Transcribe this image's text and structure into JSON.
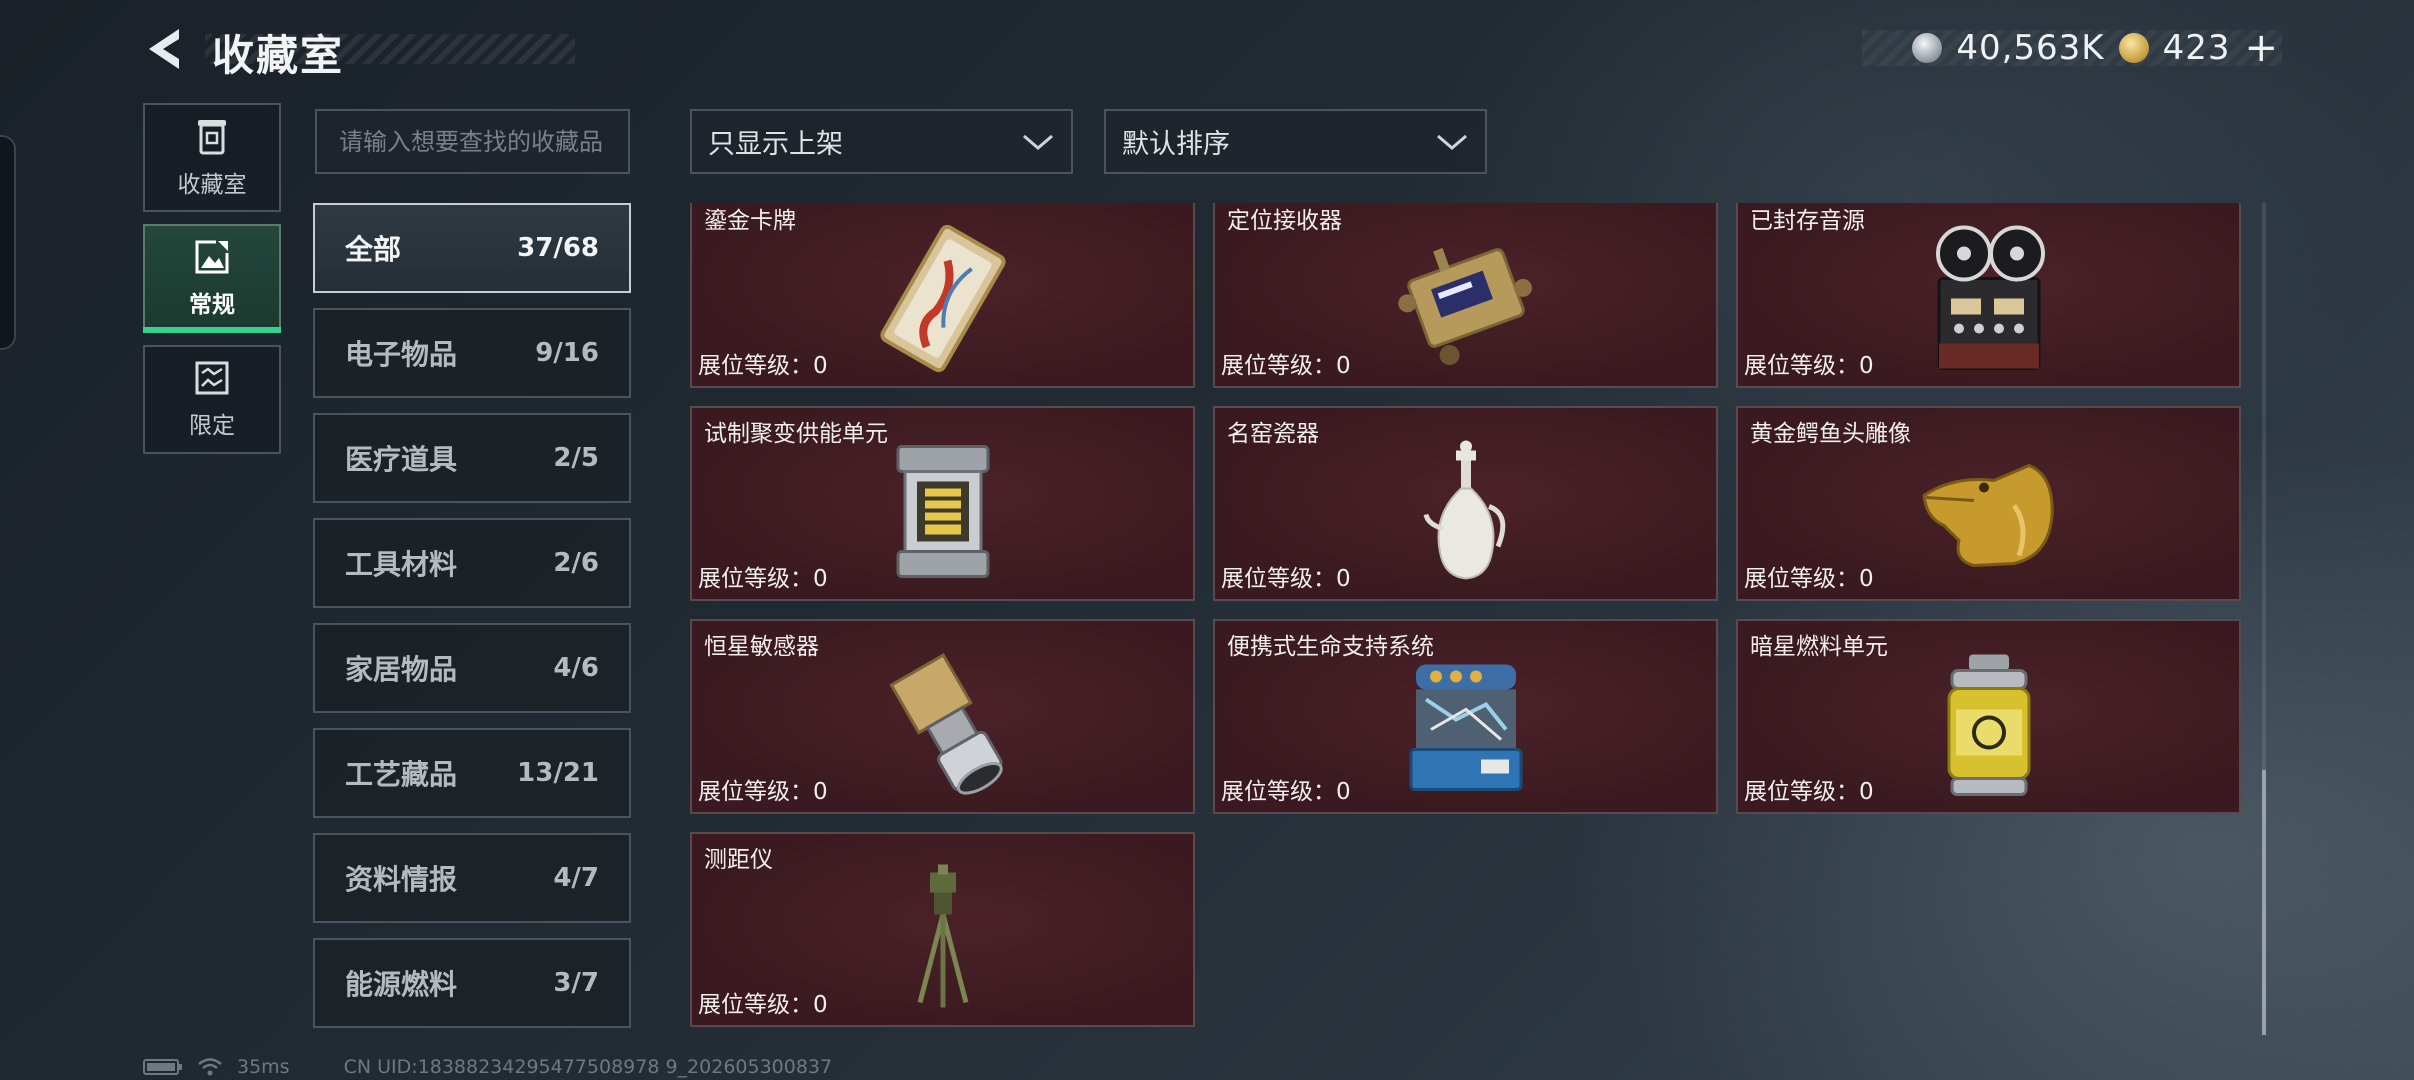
{
  "header": {
    "title": "收藏室",
    "currency_primary": "40,563K",
    "currency_secondary": "423",
    "plus": "+"
  },
  "mode_nav": [
    {
      "label": "收藏室",
      "icon": "trash-can-icon",
      "active": false
    },
    {
      "label": "常规",
      "icon": "photo-frame-icon",
      "active": true
    },
    {
      "label": "限定",
      "icon": "limited-image-icon",
      "active": false
    }
  ],
  "search": {
    "placeholder": "请输入想要查找的收藏品",
    "value": ""
  },
  "categories": [
    {
      "label": "全部",
      "count": "37/68",
      "active": true
    },
    {
      "label": "电子物品",
      "count": "9/16"
    },
    {
      "label": "医疗道具",
      "count": "2/5"
    },
    {
      "label": "工具材料",
      "count": "2/6"
    },
    {
      "label": "家居物品",
      "count": "4/6"
    },
    {
      "label": "工艺藏品",
      "count": "13/21"
    },
    {
      "label": "资料情报",
      "count": "4/7"
    },
    {
      "label": "能源燃料",
      "count": "3/7"
    }
  ],
  "filters": {
    "display_filter": "只显示上架",
    "sort": "默认排序"
  },
  "level_label": "展位等级：0",
  "items": [
    {
      "name": "鎏金卡牌",
      "icon": "gilded-card-icon"
    },
    {
      "name": "定位接收器",
      "icon": "locator-receiver-icon"
    },
    {
      "name": "已封存音源",
      "icon": "reel-to-reel-recorder-icon"
    },
    {
      "name": "试制聚变供能单元",
      "icon": "fusion-cell-icon"
    },
    {
      "name": "名窑瓷器",
      "icon": "porcelain-ewer-icon"
    },
    {
      "name": "黄金鳄鱼头雕像",
      "icon": "golden-crocodile-statue-icon"
    },
    {
      "name": "恒星敏感器",
      "icon": "star-sensor-icon"
    },
    {
      "name": "便携式生命支持系统",
      "icon": "life-support-pack-icon"
    },
    {
      "name": "暗星燃料单元",
      "icon": "fuel-canister-icon"
    },
    {
      "name": "测距仪",
      "icon": "rangefinder-tripod-icon"
    }
  ],
  "footer": {
    "ping": "35ms",
    "uid": "CN UID:18388234295477508978 9_202605300837"
  },
  "colors": {
    "accent_green": "#36d08f",
    "card_bg": "#3a1a20"
  }
}
